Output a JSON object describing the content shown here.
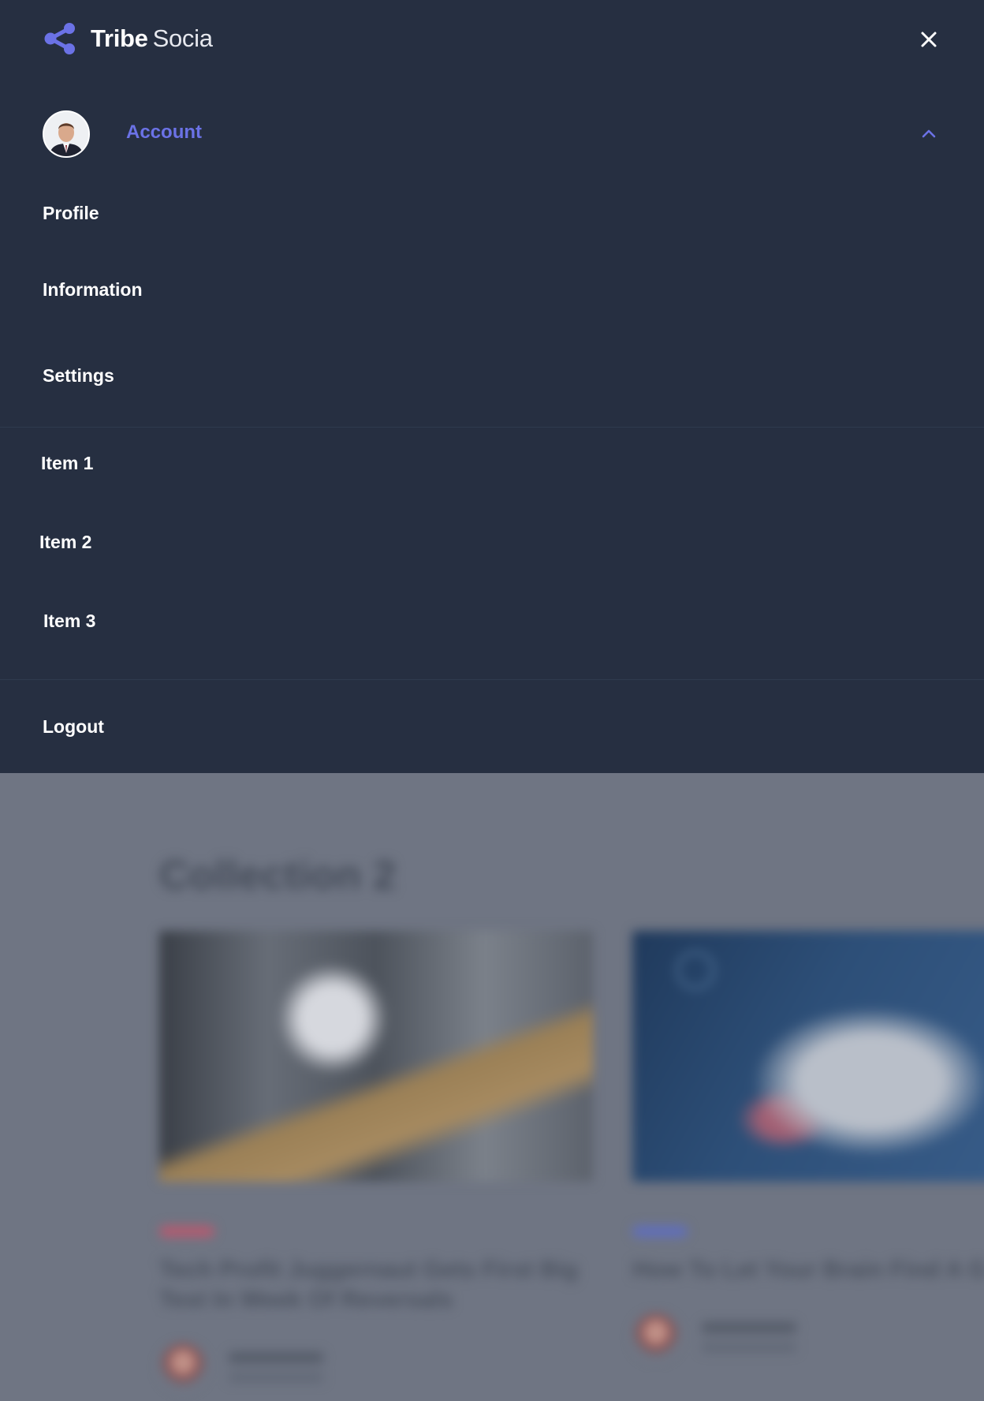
{
  "brand": {
    "name_bold": "Tribe",
    "name_light": "Socia",
    "icon": "share-icon",
    "accent": "#6b72e6"
  },
  "menu": {
    "close_icon": "close-icon",
    "account": {
      "label": "Account",
      "expanded_icon": "chevron-up-icon"
    },
    "account_items": [
      {
        "label": "Profile"
      },
      {
        "label": "Information"
      },
      {
        "label": "Settings"
      }
    ],
    "items": [
      {
        "label": "Item 1"
      },
      {
        "label": "Item 2"
      },
      {
        "label": "Item 3"
      }
    ],
    "logout": {
      "label": "Logout"
    }
  },
  "background_page": {
    "collection_title": "Collection 2",
    "cards": [
      {
        "headline": "Tech Profit Juggernaut Gets First Big Test In Week Of Reversals"
      },
      {
        "headline": "How To Let Your Brain Find A G Mike"
      }
    ]
  },
  "colors": {
    "menu_background": "#262f41",
    "overlay": "#6f7583"
  }
}
